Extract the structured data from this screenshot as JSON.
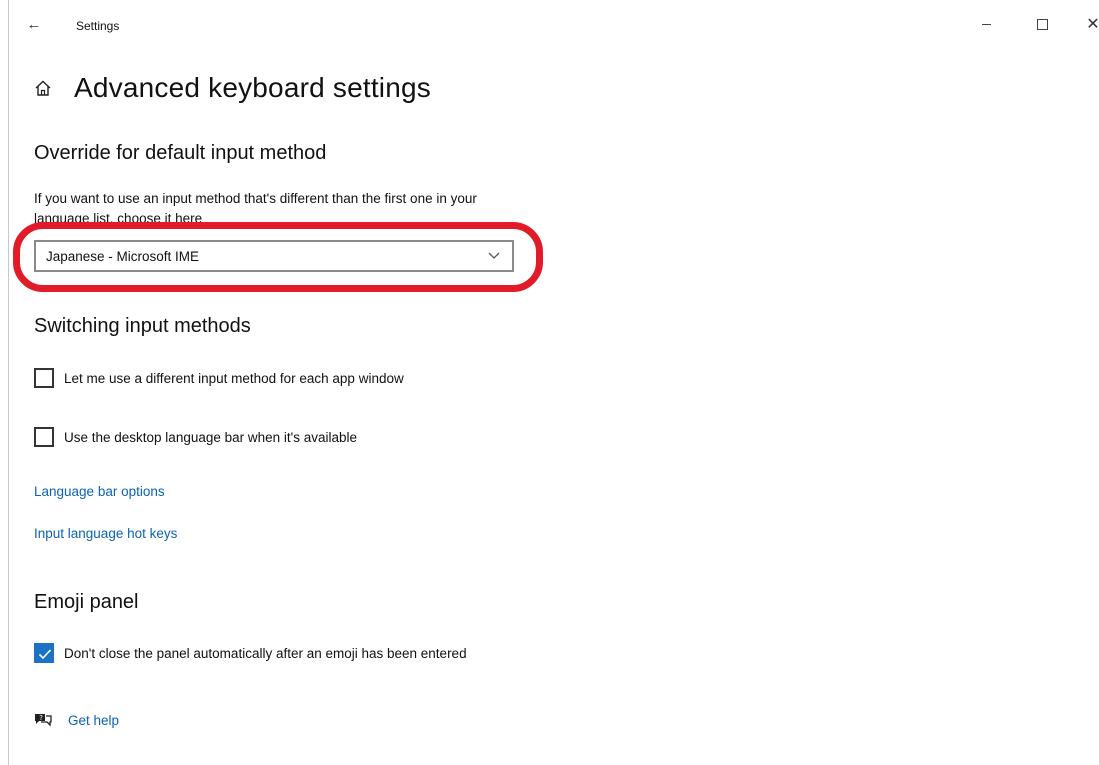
{
  "titlebar": {
    "title": "Settings",
    "back_icon": "back-arrow-icon",
    "minimize_icon": "minimize-icon",
    "maximize_icon": "maximize-icon",
    "close_icon": "close-icon",
    "close_glyph": "✕",
    "back_glyph": "←"
  },
  "page": {
    "title": "Advanced keyboard settings",
    "home_icon": "home-icon"
  },
  "override_section": {
    "title": "Override for default input method",
    "description": "If you want to use an input method that's different than the first one in your language list, choose it here",
    "dropdown_value": "Japanese - Microsoft IME",
    "highlight_color": "#e11b27"
  },
  "switching_section": {
    "title": "Switching input methods",
    "checkbox_per_app": {
      "label": "Let me use a different input method for each app window",
      "checked": false
    },
    "checkbox_language_bar": {
      "label": "Use the desktop language bar when it's available",
      "checked": false
    },
    "link_language_bar_options": "Language bar options",
    "link_hot_keys": "Input language hot keys"
  },
  "emoji_section": {
    "title": "Emoji panel",
    "checkbox_keep_open": {
      "label": "Don't close the panel automatically after an emoji has been entered",
      "checked": true
    }
  },
  "help": {
    "label": "Get help",
    "icon": "help-chat-icon"
  },
  "colors": {
    "accent": "#1a73c4",
    "link": "#0a63b8"
  }
}
